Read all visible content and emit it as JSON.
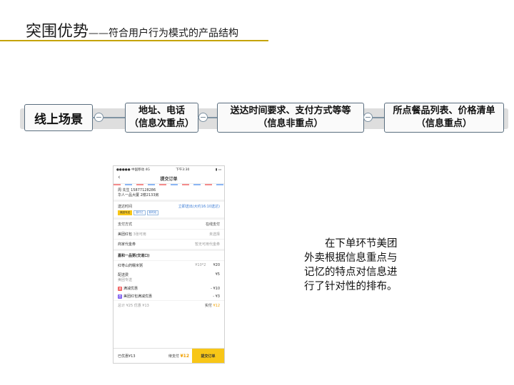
{
  "title": {
    "main": "突围优势",
    "sep": "——",
    "sub": "符合用户行为模式的产品结构"
  },
  "flow": {
    "start": "线上场景",
    "node_symbol": "−",
    "steps": [
      {
        "line1": "地址、电话",
        "line2": "（信息次重点）"
      },
      {
        "line1": "送达时间要求、支付方式等等",
        "line2": "（信息非重点）"
      },
      {
        "line1": "所点餐品列表、价格清单",
        "line2": "（信息重点）"
      }
    ]
  },
  "phone": {
    "status_left": "●●●●● 中国移动  4G",
    "status_time": "下午3:30",
    "status_right": "▮ ▭",
    "back": "‹",
    "nav_title": "提交订单",
    "contact": "周  先生    15877128286",
    "address": "华人一品大厦 2楼2133房",
    "delivery_label": "送达时间",
    "delivery_value": "立即送出(大约16:10送达)",
    "delivery_tags": [
      "美团专送",
      "准时达",
      "新时段"
    ],
    "payment_label": "支付方式",
    "payment_value": "在线支付",
    "redpacket_label": "美团红包",
    "redpacket_hint": "3张可用",
    "redpacket_value": "未选择",
    "voucher_label": "商家代金券",
    "voucher_value": "暂无可用代金券",
    "shop": "嘉和一品粥(交道口)",
    "item_name": "红枣山药糯米粥",
    "item_qty": "¥10*2",
    "item_price": "¥20",
    "fee_label": "配送费",
    "fee_sub": "美团专送",
    "fee_value": "¥5",
    "disc1_icon": "减",
    "disc1_label": "满减优惠",
    "disc1_value": "- ¥10",
    "disc2_icon": "首",
    "disc2_label": "美团红包满减优惠",
    "disc2_value": "- ¥3",
    "totals_left": "总计 ¥25   优惠 ¥13",
    "totals_pay_label": "实付",
    "totals_pay": "¥12",
    "saved": "已优惠¥13",
    "due_label": "待支付",
    "due_value": "¥12",
    "submit": "提交订单"
  },
  "description": [
    "　　在下单环节美团",
    "外卖根据信息重点与",
    "记忆的特点对信息进",
    "行了针对性的排布。"
  ]
}
